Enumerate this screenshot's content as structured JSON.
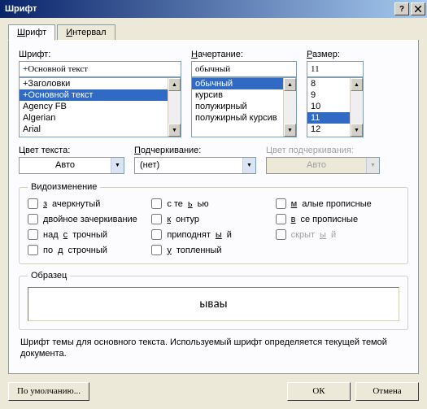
{
  "title": "Шрифт",
  "tabs": {
    "font": "Шрифт",
    "spacing": "Интервал"
  },
  "labels": {
    "font": "Шрифт:",
    "style": "Начертание:",
    "size": "Размер:",
    "color": "Цвет текста:",
    "underline": "Подчеркивание:",
    "ulcolor": "Цвет подчеркивания:",
    "effects": "Видоизменение",
    "sample": "Образец"
  },
  "font": {
    "value": "+Основной текст",
    "items": [
      "+Заголовки",
      "+Основной текст",
      "Agency FB",
      "Algerian",
      "Arial"
    ],
    "selected": "+Основной текст"
  },
  "style": {
    "value": "обычный",
    "items": [
      "обычный",
      "курсив",
      "полужирный",
      "полужирный курсив"
    ],
    "selected": "обычный"
  },
  "size": {
    "value": "11",
    "items": [
      "8",
      "9",
      "10",
      "11",
      "12"
    ],
    "selected": "11"
  },
  "color": {
    "value": "Авто"
  },
  "underline": {
    "value": "(нет)"
  },
  "ulcolor": {
    "value": "Авто"
  },
  "effects": {
    "strike": "зачеркнутый",
    "dstrike": "двойное зачеркивание",
    "super": "надстрочный",
    "sub": "подстрочный",
    "shadow": "с тенью",
    "outline": "контур",
    "emboss": "приподнятый",
    "engrave": "утопленный",
    "smallcaps": "малые прописные",
    "allcaps": "все прописные",
    "hidden": "скрытый"
  },
  "sample": "ываы",
  "hint": "Шрифт темы для основного текста. Используемый шрифт определяется текущей темой документа.",
  "buttons": {
    "default": "По умолчанию...",
    "ok": "ОК",
    "cancel": "Отмена"
  }
}
